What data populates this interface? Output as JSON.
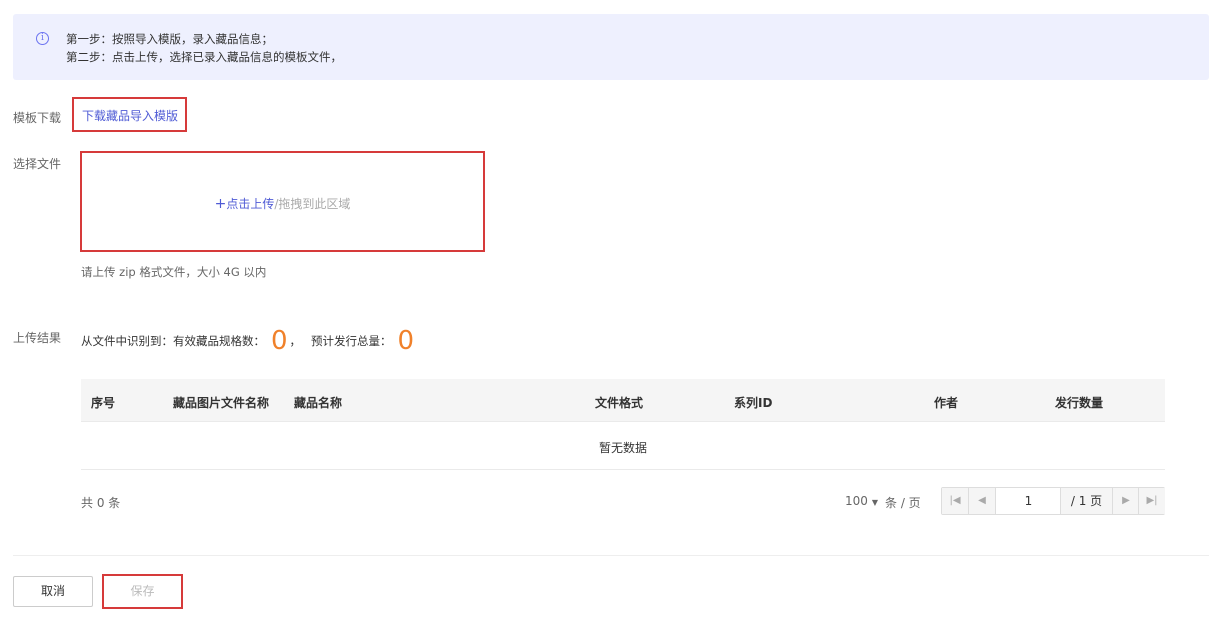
{
  "notice": {
    "icon": "info-icon",
    "step1": "第一步：按照导入模版，录入藏品信息；",
    "step2": "第二步：点击上传，选择已录入藏品信息的模板文件，"
  },
  "template": {
    "label": "模板下载",
    "link": "下载藏品导入模版"
  },
  "file": {
    "label": "选择文件",
    "plus": "+",
    "click_upload": "点击上传",
    "drag_text": "/拖拽到此区域",
    "hint": "请上传 zip 格式文件，大小 4G 以内"
  },
  "result": {
    "label": "上传结果",
    "prefix": "从文件中识别到：有效藏品规格数：",
    "valid_count": "0",
    "sep": "，",
    "issue_label": "预计发行总量：",
    "issue_total": "0"
  },
  "table": {
    "columns": [
      "序号",
      "藏品图片文件名称",
      "藏品名称",
      "文件格式",
      "系列ID",
      "作者",
      "发行数量"
    ],
    "empty": "暂无数据"
  },
  "pagination": {
    "total": "共 0 条",
    "page_size": "100",
    "per_page": "条 / 页",
    "current_page": "1",
    "page_total": "/ 1 页"
  },
  "actions": {
    "cancel": "取消",
    "save": "保存"
  },
  "colors": {
    "accent": "#4f5bd5",
    "highlight_orange": "#f0812a",
    "notice_bg": "#eef0fe",
    "annotation_red": "#d63a3a"
  }
}
